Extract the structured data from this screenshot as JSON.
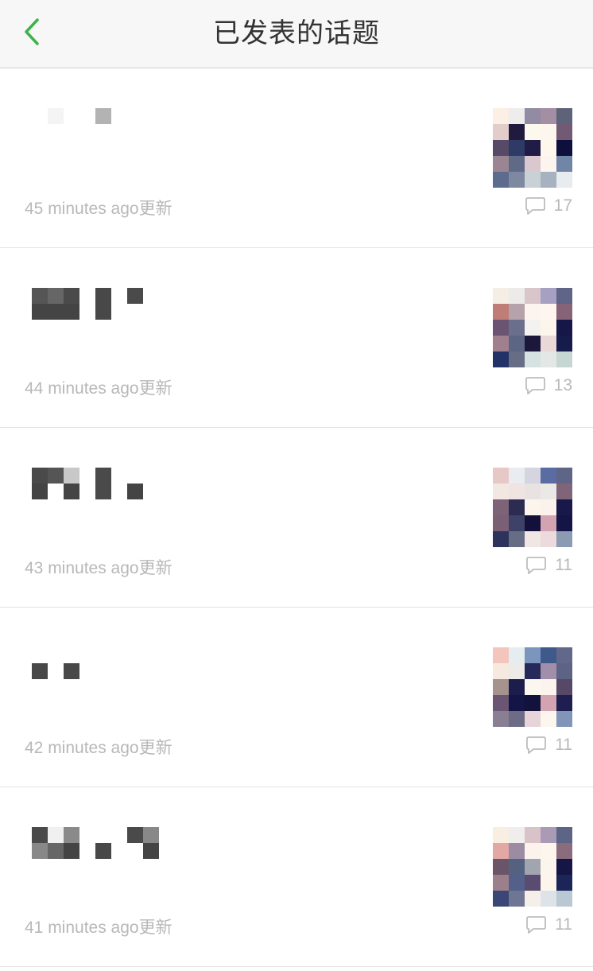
{
  "header": {
    "title": "已发表的话题",
    "back_icon": "chevron-left-icon",
    "accent_color": "#3cb34a"
  },
  "topics": [
    {
      "updated": "45 minutes ago更新",
      "comment_count": "17",
      "title_blocks": [
        [
          1,
          0,
          "#f4f4f4"
        ],
        [
          4,
          0,
          "#b3b3b3"
        ]
      ],
      "thumb": [
        "#fcefe4",
        "#efecee",
        "#918ba4",
        "#a38ea4",
        "#5e6379",
        "#e2cdca",
        "#211a3f",
        "#fdf8ee",
        "#fcf6ee",
        "#735a74",
        "#574a66",
        "#2e3b66",
        "#201c45",
        "#fdf7ec",
        "#0f0f3d",
        "#9b8592",
        "#5f6b86",
        "#dbc8cf",
        "#fcf4ee",
        "#7185a7",
        "#5c6b8e",
        "#7e88a0",
        "#c8d1d6",
        "#a6b2c0",
        "#e8ecef"
      ]
    },
    {
      "updated": "44 minutes ago更新",
      "comment_count": "13",
      "title_blocks": [
        [
          0,
          0,
          "#555555"
        ],
        [
          1,
          0,
          "#666666"
        ],
        [
          2,
          0,
          "#4a4a4a"
        ],
        [
          0,
          1,
          "#444444"
        ],
        [
          1,
          1,
          "#444444"
        ],
        [
          2,
          1,
          "#444444"
        ],
        [
          4,
          0,
          "#484848"
        ],
        [
          4,
          1,
          "#484848"
        ],
        [
          6,
          0,
          "#4a4a4a"
        ]
      ],
      "thumb": [
        "#f5eee4",
        "#ecebea",
        "#d8c6cb",
        "#a8a0c3",
        "#5e6586",
        "#c07c77",
        "#b6a2ab",
        "#fcf4ee",
        "#fdf6ee",
        "#866376",
        "#6b5472",
        "#6a6f8b",
        "#f4f2f0",
        "#fbf5ec",
        "#161648",
        "#a0808d",
        "#5d6584",
        "#1c183c",
        "#e9d8d8",
        "#151c4c",
        "#223166",
        "#676d85",
        "#d6e2e2",
        "#e3e8e6",
        "#c6d6d2"
      ]
    },
    {
      "updated": "43 minutes ago更新",
      "comment_count": "11",
      "title_blocks": [
        [
          0,
          0,
          "#4a4a4a"
        ],
        [
          1,
          0,
          "#555555"
        ],
        [
          2,
          0,
          "#c8c8c8"
        ],
        [
          0,
          1,
          "#444444"
        ],
        [
          2,
          1,
          "#444444"
        ],
        [
          4,
          0,
          "#4a4a4a"
        ],
        [
          4,
          1,
          "#4a4a4a"
        ],
        [
          6,
          1,
          "#444444"
        ]
      ],
      "thumb": [
        "#e6c9c6",
        "#e9ecf0",
        "#d4d5df",
        "#5a6ca3",
        "#5e6586",
        "#f3e8e1",
        "#efe4e2",
        "#e9e2e2",
        "#ebe9e6",
        "#806478",
        "#7d6378",
        "#2c2c52",
        "#fcf5ec",
        "#fbf3eb",
        "#18184a",
        "#7a5f75",
        "#3e4269",
        "#13103b",
        "#d4a3b2",
        "#141446",
        "#2e335e",
        "#676d85",
        "#f0e6e3",
        "#ecdadd",
        "#8b9bb2"
      ]
    },
    {
      "updated": "42 minutes ago更新",
      "comment_count": "11",
      "title_blocks": [
        [
          0,
          1,
          "#484848"
        ],
        [
          2,
          1,
          "#484848"
        ]
      ],
      "thumb": [
        "#f4c5bd",
        "#e6edf0",
        "#7c95bd",
        "#3d5a8a",
        "#61688a",
        "#f6eae0",
        "#ecebe8",
        "#26295a",
        "#a18ea8",
        "#5d6384",
        "#a7938e",
        "#1c1d4c",
        "#fcf7ee",
        "#faf4ed",
        "#574868",
        "#6a5672",
        "#141446",
        "#12123d",
        "#d3a3b2",
        "#1e1f50",
        "#8a7e92",
        "#6d6b86",
        "#e6d4d8",
        "#fcf6ef",
        "#8195b8"
      ]
    },
    {
      "updated": "41 minutes ago更新",
      "comment_count": "11",
      "title_blocks": [
        [
          0,
          0,
          "#4a4a4a"
        ],
        [
          1,
          0,
          "#f0f0f0"
        ],
        [
          2,
          0,
          "#8a8a8a"
        ],
        [
          0,
          1,
          "#888888"
        ],
        [
          1,
          1,
          "#666666"
        ],
        [
          2,
          1,
          "#444444"
        ],
        [
          4,
          1,
          "#484848"
        ],
        [
          6,
          0,
          "#4a4a4a"
        ],
        [
          7,
          0,
          "#888888"
        ],
        [
          7,
          1,
          "#444444"
        ]
      ],
      "thumb": [
        "#f8eee2",
        "#efeeec",
        "#d9c2c8",
        "#aa9ab6",
        "#5d6586",
        "#e3a8a4",
        "#9b8ca3",
        "#fbf3ec",
        "#fdf6ec",
        "#8a6c7c",
        "#6a5568",
        "#55627f",
        "#a0a5b0",
        "#fcf5ee",
        "#161646",
        "#9b7f8a",
        "#53608a",
        "#5a4c70",
        "#fdf5ec",
        "#1b2558",
        "#3a4675",
        "#6e7693",
        "#f5efe9",
        "#dde3e8",
        "#b9c8d3"
      ]
    }
  ]
}
